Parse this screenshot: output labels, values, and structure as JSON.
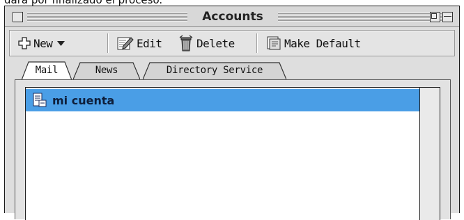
{
  "caption": "dará por finalizado el proceso.",
  "window": {
    "title": "Accounts"
  },
  "toolbar": {
    "new_label": "New",
    "edit_label": "Edit",
    "delete_label": "Delete",
    "make_default_label": "Make Default"
  },
  "tabs": [
    {
      "label": "Mail",
      "active": true
    },
    {
      "label": "News",
      "active": false
    },
    {
      "label": "Directory Service",
      "active": false
    }
  ],
  "accounts": [
    {
      "name": "mi cuenta",
      "selected": true,
      "icon": "mail-account-icon"
    }
  ],
  "colors": {
    "selection": "#4a9ee6",
    "window_bg": "#dedede"
  }
}
